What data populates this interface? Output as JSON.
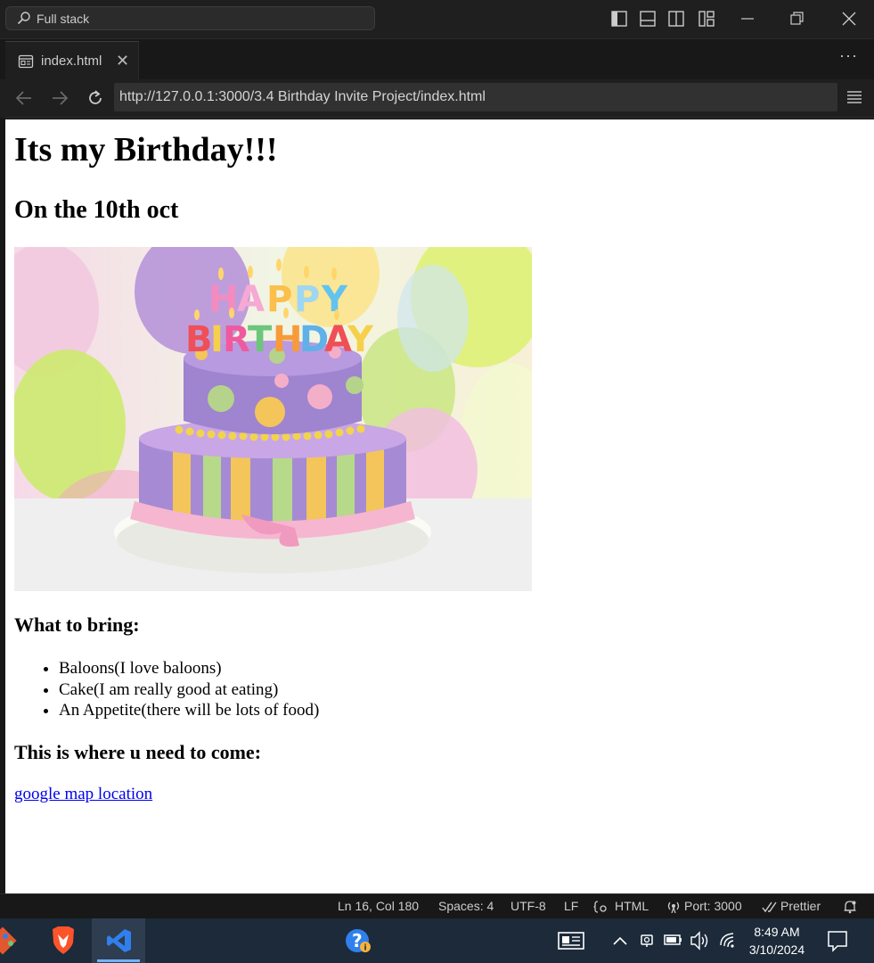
{
  "titlebar": {
    "search_text": "Full stack"
  },
  "tab": {
    "label": "index.html",
    "close": "✕"
  },
  "tabbar": {
    "more": "···"
  },
  "navbar": {
    "url": "http://127.0.0.1:3000/3.4 Birthday Invite Project/index.html"
  },
  "page": {
    "heading": "Its my Birthday!!!",
    "date": "On the 10th oct",
    "cake_image": {
      "label_top": "HAPPY",
      "label_bottom": "BIRTHDAY",
      "icon": "birthday-cake-photo"
    },
    "bring_heading": "What to bring:",
    "bring_items": [
      "Baloons(I love baloons)",
      "Cake(I am really good at eating)",
      "An Appetite(there will be lots of food)"
    ],
    "where_heading": "This is where u need to come:",
    "map_link": "google map location"
  },
  "statusbar": {
    "position": "Ln 16, Col 180",
    "spaces": "Spaces: 4",
    "encoding": "UTF-8",
    "eol": "LF",
    "language": "HTML",
    "port": "Port: 3000",
    "prettier": "Prettier"
  },
  "taskbar": {
    "time": "8:49 AM",
    "date": "3/10/2024"
  },
  "colors": {
    "editor_bg": "#1f1f1f",
    "link": "#0000ee",
    "taskbar": "#1c2a3a",
    "vscode_blue": "#2f80ed"
  }
}
